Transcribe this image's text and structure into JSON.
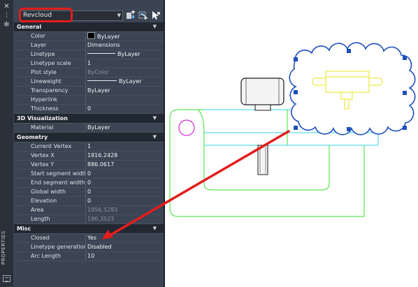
{
  "palette": {
    "title": "PROPERTIES",
    "selected_object": "Revcloud"
  },
  "categories": [
    {
      "name": "General",
      "rows": [
        {
          "key": "Color",
          "value": "ByLayer",
          "swatch": "#000000"
        },
        {
          "key": "Layer",
          "value": "Dimensions"
        },
        {
          "key": "Linetype",
          "value": "ByLayer",
          "line": true
        },
        {
          "key": "Linetype scale",
          "value": "1"
        },
        {
          "key": "Plot style",
          "value": "ByColor",
          "dim": true
        },
        {
          "key": "Lineweight",
          "value": "ByLayer",
          "line": true
        },
        {
          "key": "Transparency",
          "value": "ByLayer"
        },
        {
          "key": "Hyperlink",
          "value": ""
        },
        {
          "key": "Thickness",
          "value": "0"
        }
      ]
    },
    {
      "name": "3D Visualization",
      "rows": [
        {
          "key": "Material",
          "value": "ByLayer"
        }
      ]
    },
    {
      "name": "Geometry",
      "rows": [
        {
          "key": "Current Vertex",
          "value": "1"
        },
        {
          "key": "Vertex X",
          "value": "1816.2428"
        },
        {
          "key": "Vertex Y",
          "value": "886.0617"
        },
        {
          "key": "Start segment width",
          "value": "0"
        },
        {
          "key": "End segment width",
          "value": "0"
        },
        {
          "key": "Global width",
          "value": "0"
        },
        {
          "key": "Elevation",
          "value": "0"
        },
        {
          "key": "Area",
          "value": "1956.5283",
          "dim": true
        },
        {
          "key": "Length",
          "value": "190.3523",
          "dim": true
        }
      ]
    },
    {
      "name": "Misc",
      "rows": [
        {
          "key": "Closed",
          "value": "Yes"
        },
        {
          "key": "Linetype generation",
          "value": "Disabled"
        },
        {
          "key": "Arc Length",
          "value": "10"
        }
      ]
    }
  ],
  "colors": {
    "highlight": "#e31d1d",
    "selection": "#1f4fbf",
    "yellow_layer": "#e8e41a",
    "cyan_layer": "#36d6e6",
    "green_layer": "#38e02e",
    "magenta_layer": "#d62ad6"
  },
  "icons": [
    "close-icon",
    "pin-icon",
    "settings-icon",
    "quick-select-icon",
    "select-objects-icon",
    "toggle-pickadd-icon",
    "dropdown-arrow-icon",
    "collapse-chevron-icon"
  ]
}
